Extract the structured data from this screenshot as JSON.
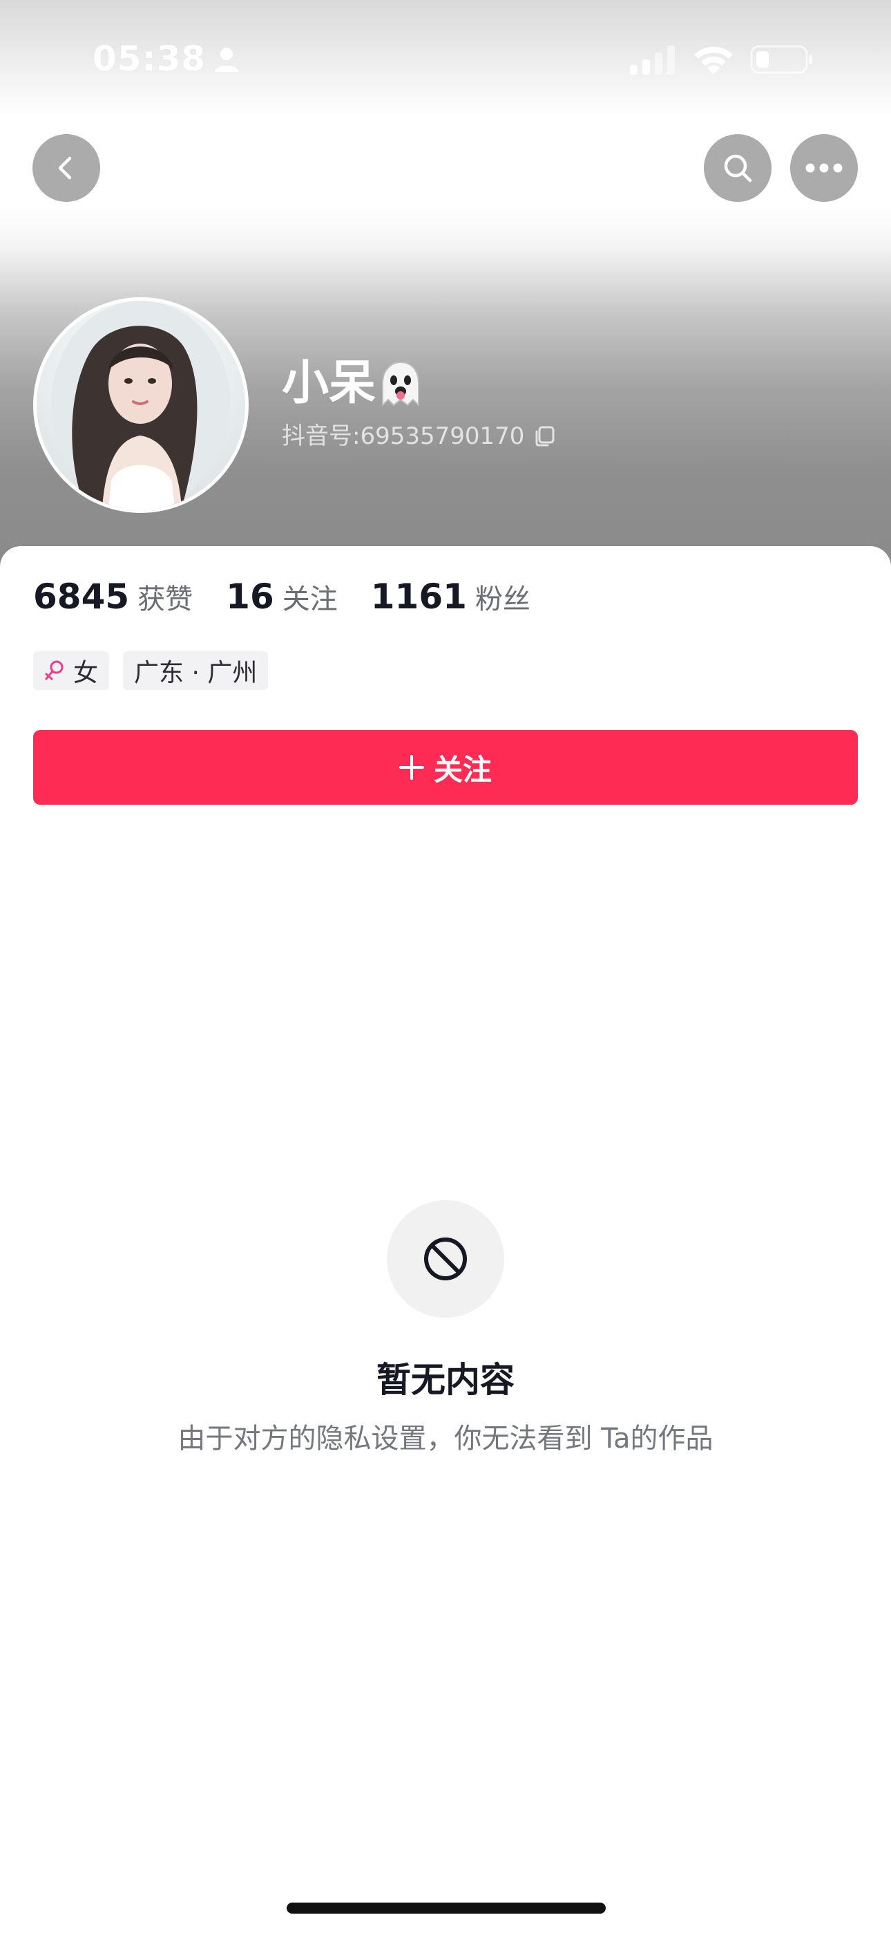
{
  "status_bar": {
    "time": "05:38"
  },
  "nav": {
    "back_icon": "chevron-left-icon",
    "search_icon": "search-icon",
    "more_icon": "more-horizontal-icon"
  },
  "profile": {
    "name": "小呆",
    "name_emoji": "ghost-tongue-emoji",
    "douyin_id_label": "抖音号:",
    "douyin_id": "69535790170"
  },
  "stats": [
    {
      "value": "6845",
      "label": "获赞"
    },
    {
      "value": "16",
      "label": "关注"
    },
    {
      "value": "1161",
      "label": "粉丝"
    }
  ],
  "tags": {
    "gender": "女",
    "location": "广东 · 广州"
  },
  "follow_button": {
    "label": "关注"
  },
  "empty_state": {
    "title": "暂无内容",
    "description": "由于对方的隐私设置，你无法看到 Ta的作品"
  },
  "colors": {
    "accent": "#fe2c55",
    "gender_female": "#e83e8c",
    "text_primary": "#161823",
    "text_secondary": "#75777e"
  }
}
